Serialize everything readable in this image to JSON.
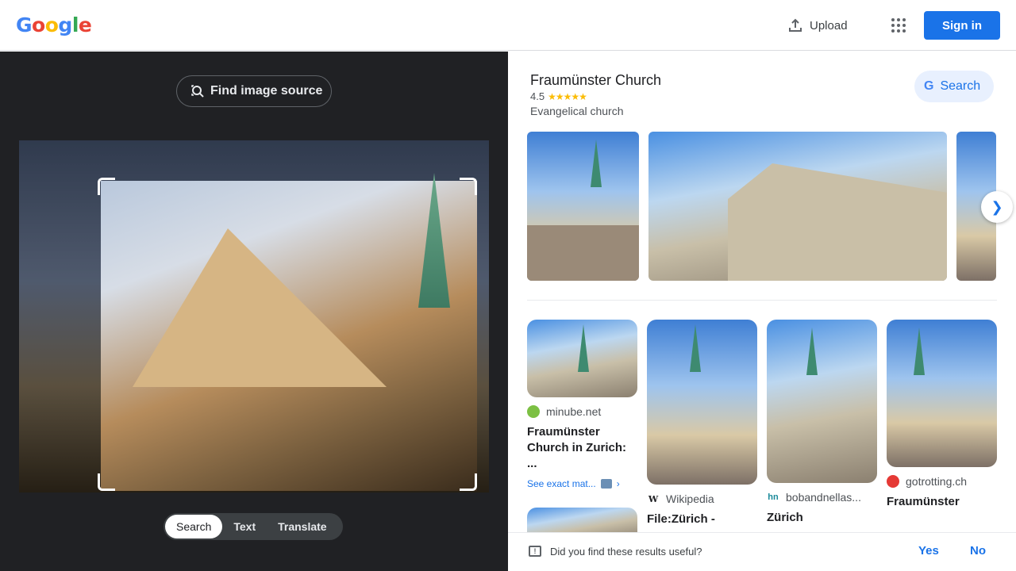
{
  "header": {
    "logo_letters": [
      "G",
      "o",
      "o",
      "g",
      "l",
      "e"
    ],
    "upload_label": "Upload",
    "apps_icon": "apps-grid-icon",
    "signin_label": "Sign in"
  },
  "left_panel": {
    "find_source_label": "Find image source",
    "modes": [
      {
        "label": "Search",
        "active": true
      },
      {
        "label": "Text",
        "active": false
      },
      {
        "label": "Translate",
        "active": false
      }
    ]
  },
  "knowledge_panel": {
    "title": "Fraumünster Church",
    "rating": "4.5",
    "stars": "★★★★★",
    "subtitle": "Evangelical church",
    "search_label": "Search"
  },
  "results": [
    {
      "source": "minube.net",
      "favicon_color": "#7cc043",
      "title": "Fraumünster Church in Zurich: ...",
      "exact_match_label": "See exact mat..."
    },
    {
      "source": "Wikipedia",
      "favicon_color": "#202124",
      "favicon_glyph": "W",
      "title": "File:Zürich -"
    },
    {
      "source": "bobandnellas...",
      "favicon_color": "#1a8a9a",
      "favicon_glyph": "hn",
      "title": "Zürich"
    },
    {
      "source": "gotrotting.ch",
      "favicon_color": "#e53935",
      "title": "Fraumünster"
    }
  ],
  "feedback": {
    "question": "Did you find these results useful?",
    "yes_label": "Yes",
    "no_label": "No"
  },
  "colors": {
    "accent": "#1a73e8",
    "left_bg": "#202124"
  }
}
